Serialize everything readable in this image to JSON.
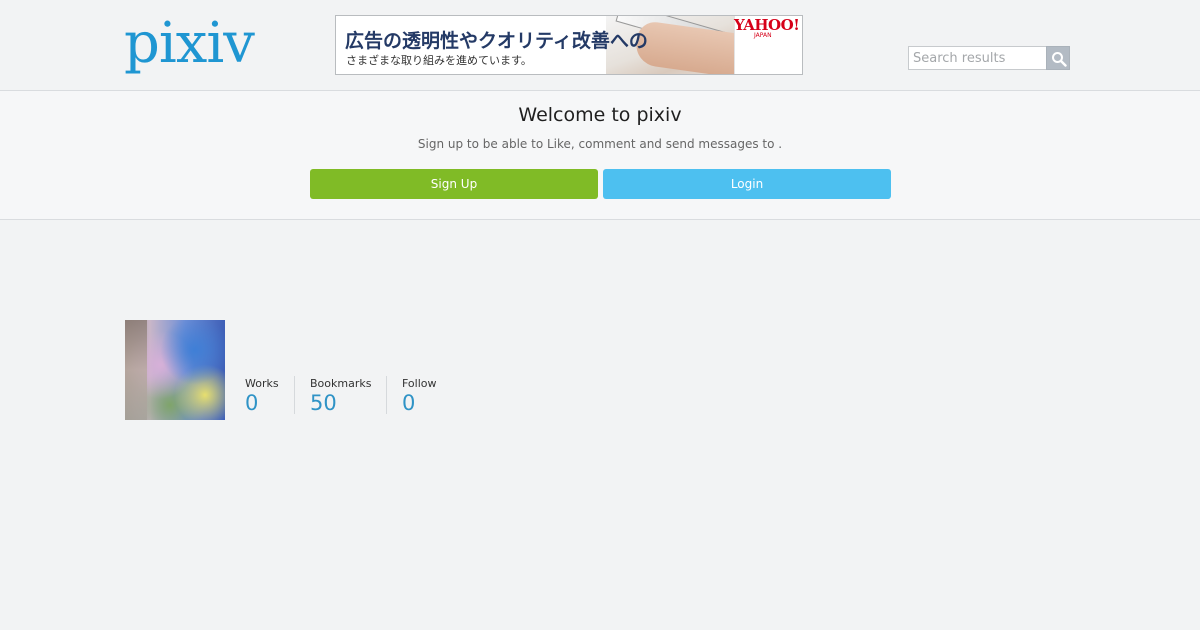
{
  "header": {
    "logo_text": "pixiv",
    "brand_color": "#1f96d2",
    "ad": {
      "line1": "広告の透明性やクオリティ改善への",
      "line2": "さまざまな取り組みを進めています。",
      "brand": "YAHOO!",
      "brand_sub": "JAPAN"
    },
    "search": {
      "placeholder": "Search results",
      "button_icon": "search-icon"
    }
  },
  "welcome": {
    "title": "Welcome to pixiv",
    "subtitle": "Sign up to be able to Like, comment and send messages to .",
    "signup_label": "Sign Up",
    "login_label": "Login",
    "signup_color": "#80bb26",
    "login_color": "#4dc0f0"
  },
  "profile": {
    "stats": [
      {
        "label": "Works",
        "value": "0"
      },
      {
        "label": "Bookmarks",
        "value": "50"
      },
      {
        "label": "Follow",
        "value": "0"
      }
    ]
  }
}
